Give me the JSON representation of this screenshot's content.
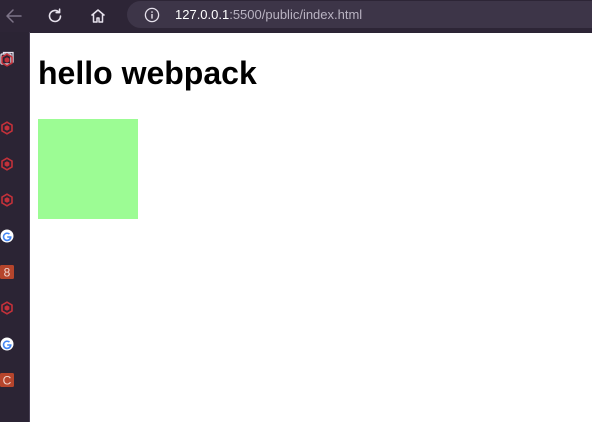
{
  "browser": {
    "address_host": "127.0.0.1",
    "address_path": ":5500/public/index.html"
  },
  "sidebar": {
    "items": [
      {
        "icon": "bookmark-icon",
        "color": "#c3313a"
      },
      {
        "icon": "bookmark-icon",
        "color": "#c3313a"
      },
      {
        "icon": "bookmark-icon",
        "color": "#c3313a"
      },
      {
        "icon": "bookmark-icon",
        "color": "#c3313a"
      },
      {
        "icon": "google-icon"
      },
      {
        "icon": "bookmark-8-icon",
        "label": "8",
        "color": "#b5452c"
      },
      {
        "icon": "bookmark-icon",
        "color": "#c3313a"
      },
      {
        "icon": "google-icon"
      },
      {
        "icon": "bookmark-c-icon",
        "label": "C",
        "color": "#b5452c"
      }
    ]
  },
  "page": {
    "heading": "hello webpack",
    "box_color": "#9cfc94"
  }
}
